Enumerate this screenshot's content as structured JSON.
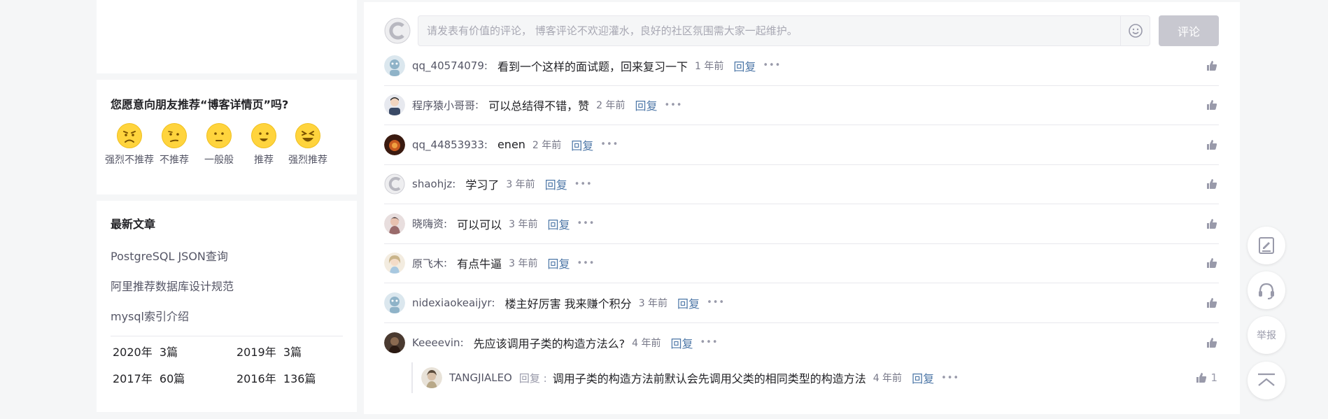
{
  "recommend": {
    "title": "您愿意向朋友推荐“博客详情页”吗?",
    "options": [
      {
        "label": "强烈不推荐",
        "icon": "strongly-dislike-face-icon"
      },
      {
        "label": "不推荐",
        "icon": "dislike-face-icon"
      },
      {
        "label": "一般般",
        "icon": "neutral-face-icon"
      },
      {
        "label": "推荐",
        "icon": "like-face-icon"
      },
      {
        "label": "强烈推荐",
        "icon": "strongly-like-face-icon"
      }
    ]
  },
  "latest": {
    "title": "最新文章",
    "articles": [
      "PostgreSQL JSON查询",
      "阿里推荐数据库设计规范",
      "mysql索引介绍"
    ],
    "archive": [
      {
        "year": "2020年",
        "count": "3篇"
      },
      {
        "year": "2019年",
        "count": "3篇"
      },
      {
        "year": "2017年",
        "count": "60篇"
      },
      {
        "year": "2016年",
        "count": "136篇"
      }
    ]
  },
  "comment_box": {
    "placeholder": "请发表有价值的评论， 博客评论不欢迎灌水，良好的社区氛围需大家一起维护。",
    "submit_label": "评论"
  },
  "comments": [
    {
      "name": "qq_40574079",
      "text": "看到一个这样的面试题，回来复习一下",
      "time": "1 年前",
      "reply": "回复",
      "more": "•••",
      "avatar_color": "#8fb3c8"
    },
    {
      "name": "程序猿小哥哥",
      "text": "可以总结得不错，赞",
      "time": "2 年前",
      "reply": "回复",
      "more": "•••",
      "avatar_color": "#3a4a66"
    },
    {
      "name": "qq_44853933",
      "text": "enen",
      "time": "2 年前",
      "reply": "回复",
      "more": "•••",
      "avatar_color": "#8a3a1a"
    },
    {
      "name": "shaohjz",
      "text": "学习了",
      "time": "3 年前",
      "reply": "回复",
      "more": "•••",
      "avatar_color": "#c8c8cc"
    },
    {
      "name": "晓嗨资",
      "text": "可以可以",
      "time": "3 年前",
      "reply": "回复",
      "more": "•••",
      "avatar_color": "#9a6b6b"
    },
    {
      "name": "原飞木",
      "text": "有点牛逼",
      "time": "3 年前",
      "reply": "回复",
      "more": "•••",
      "avatar_color": "#c9b48a"
    },
    {
      "name": "nidexiaokeaijyr",
      "text": "楼主好厉害 我来赚个积分",
      "time": "3 年前",
      "reply": "回复",
      "more": "•••",
      "avatar_color": "#8fb3c8"
    },
    {
      "name": "Keeeevin",
      "text": "先应该调用子类的构造方法么?",
      "time": "4 年前",
      "reply": "回复",
      "more": "•••",
      "avatar_color": "#5a3a2a"
    }
  ],
  "sub_comment": {
    "name": "TANGJIALEO",
    "reply_tag": "回复 :",
    "text": "调用子类的构造方法前默认会先调用父类的相同类型的构造方法",
    "time": "4 年前",
    "reply": "回复",
    "more": "•••",
    "likes": "1",
    "avatar_color": "#b8a888"
  },
  "sidebar_tools": {
    "report_label": "举报"
  },
  "colors": {
    "accent_link": "#4d77a7",
    "emoji_yellow": "#ffd43d",
    "submit_disabled": "#c8c8d0"
  }
}
